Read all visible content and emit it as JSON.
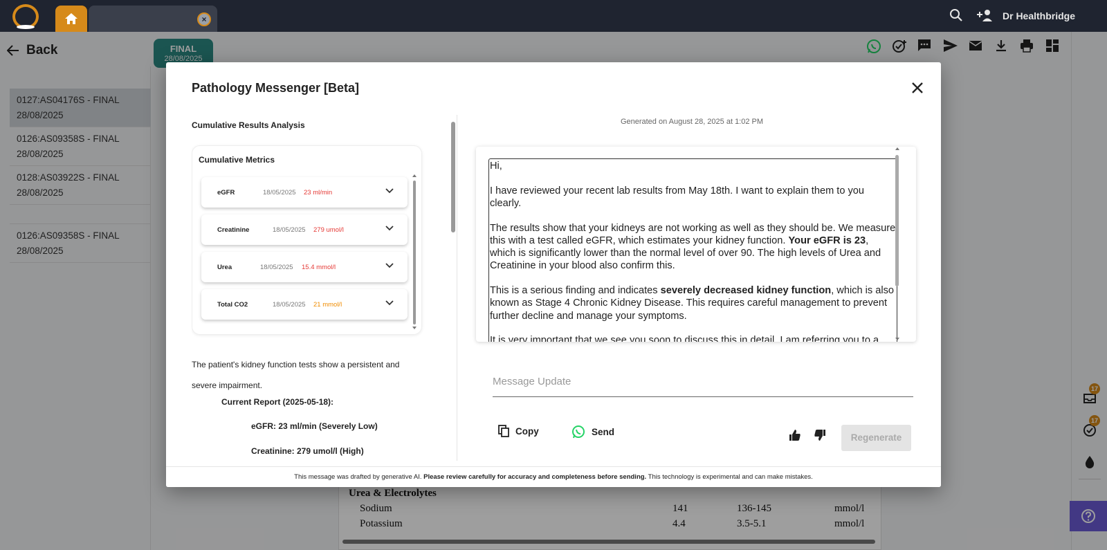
{
  "topbar": {
    "user_name": "Dr Healthbridge"
  },
  "nav": {
    "back_label": "Back"
  },
  "report_badge": {
    "status": "FINAL",
    "date": "28/08/2025"
  },
  "reports": [
    {
      "label": "0127:AS04176S - FINAL 28/08/2025"
    },
    {
      "label": "0126:AS09358S - FINAL 28/08/2025"
    },
    {
      "label": "0128:AS03922S - FINAL 28/08/2025"
    },
    {
      "label": "0126:AS09358S - FINAL 28/08/2025"
    }
  ],
  "rail": {
    "badge1": "17",
    "badge2": "17"
  },
  "report_view": {
    "heading": "Urea & Electrolytes",
    "rows": [
      {
        "test": "Sodium",
        "value": "141",
        "range": "136-145",
        "unit": "mmol/l"
      },
      {
        "test": "Potassium",
        "value": "4.4",
        "range": "3.5-5.1",
        "unit": "mmol/l"
      }
    ]
  },
  "modal": {
    "title": "Pathology Messenger [Beta]",
    "left": {
      "section_title": "Cumulative Results Analysis",
      "metrics_title": "Cumulative Metrics",
      "metrics": [
        {
          "name": "eGFR",
          "date": "18/05/2025",
          "value": "23 ml/min",
          "color": "#e53935"
        },
        {
          "name": "Creatinine",
          "date": "18/05/2025",
          "value": "279 umol/l",
          "color": "#e53935"
        },
        {
          "name": "Urea",
          "date": "18/05/2025",
          "value": "15.4 mmol/l",
          "color": "#e53935"
        },
        {
          "name": "Total CO2",
          "date": "18/05/2025",
          "value": "21 mmol/l",
          "color": "#f08c00"
        }
      ],
      "summary": "The patient's kidney function tests show a persistent and severe impairment.",
      "current_report": "Current Report (2025-05-18):",
      "items": [
        "eGFR: 23 ml/min (Severely Low)",
        "Creatinine: 279 umol/l (High)"
      ]
    },
    "right": {
      "generated": "Generated on August 28, 2025 at 1:02 PM",
      "message": {
        "greeting": "Hi,",
        "p1": "I have reviewed your recent lab results from May 18th. I want to explain them to you clearly.",
        "p2_a": "The results show that your kidneys are not working as well as they should be. We measure this with a test called eGFR, which estimates your kidney function. ",
        "p2_b": "Your eGFR is 23",
        "p2_c": ", which is significantly lower than the normal level of over 90. The high levels of Urea and Creatinine in your blood also confirm this.",
        "p3_a": "This is a serious finding and indicates ",
        "p3_b": "severely decreased kidney function",
        "p3_c": ", which is also known as Stage 4 Chronic Kidney Disease. This requires careful management to prevent further decline and manage your symptoms.",
        "p4": "It is very important that we see you soon to discuss this in detail. I am referring you to a"
      },
      "message_update_placeholder": "Message Update",
      "copy_label": "Copy",
      "send_label": "Send",
      "regenerate_label": "Regenerate"
    },
    "disclaimer": {
      "pre": "This message was drafted by generative AI. ",
      "bold": "Please review carefully for accuracy and completeness before sending.",
      "post": " This technology is experimental and can make mistakes."
    }
  },
  "colors": {
    "brand": "#d68a1a",
    "topbar": "#1f2430",
    "teal": "#2c8a84",
    "help": "#6b5bd6",
    "whatsapp": "#25d366"
  }
}
